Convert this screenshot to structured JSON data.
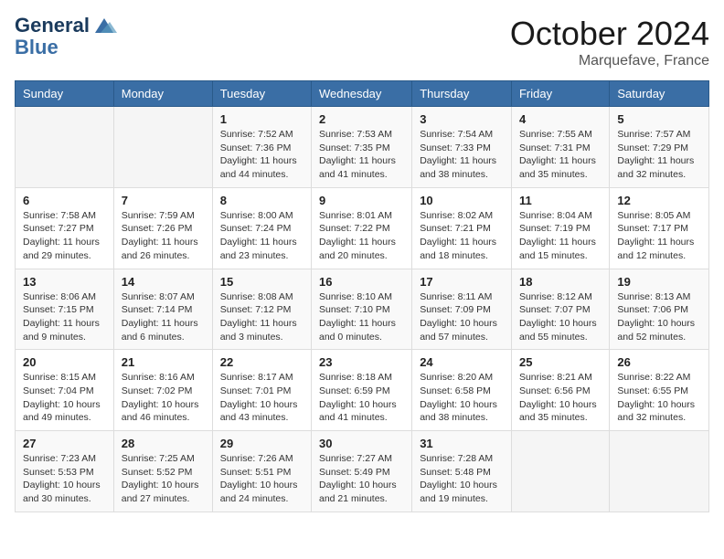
{
  "header": {
    "logo_line1": "General",
    "logo_line2": "Blue",
    "month": "October 2024",
    "location": "Marquefave, France"
  },
  "days_of_week": [
    "Sunday",
    "Monday",
    "Tuesday",
    "Wednesday",
    "Thursday",
    "Friday",
    "Saturday"
  ],
  "weeks": [
    [
      {
        "day": "",
        "content": ""
      },
      {
        "day": "",
        "content": ""
      },
      {
        "day": "1",
        "content": "Sunrise: 7:52 AM\nSunset: 7:36 PM\nDaylight: 11 hours and 44 minutes."
      },
      {
        "day": "2",
        "content": "Sunrise: 7:53 AM\nSunset: 7:35 PM\nDaylight: 11 hours and 41 minutes."
      },
      {
        "day": "3",
        "content": "Sunrise: 7:54 AM\nSunset: 7:33 PM\nDaylight: 11 hours and 38 minutes."
      },
      {
        "day": "4",
        "content": "Sunrise: 7:55 AM\nSunset: 7:31 PM\nDaylight: 11 hours and 35 minutes."
      },
      {
        "day": "5",
        "content": "Sunrise: 7:57 AM\nSunset: 7:29 PM\nDaylight: 11 hours and 32 minutes."
      }
    ],
    [
      {
        "day": "6",
        "content": "Sunrise: 7:58 AM\nSunset: 7:27 PM\nDaylight: 11 hours and 29 minutes."
      },
      {
        "day": "7",
        "content": "Sunrise: 7:59 AM\nSunset: 7:26 PM\nDaylight: 11 hours and 26 minutes."
      },
      {
        "day": "8",
        "content": "Sunrise: 8:00 AM\nSunset: 7:24 PM\nDaylight: 11 hours and 23 minutes."
      },
      {
        "day": "9",
        "content": "Sunrise: 8:01 AM\nSunset: 7:22 PM\nDaylight: 11 hours and 20 minutes."
      },
      {
        "day": "10",
        "content": "Sunrise: 8:02 AM\nSunset: 7:21 PM\nDaylight: 11 hours and 18 minutes."
      },
      {
        "day": "11",
        "content": "Sunrise: 8:04 AM\nSunset: 7:19 PM\nDaylight: 11 hours and 15 minutes."
      },
      {
        "day": "12",
        "content": "Sunrise: 8:05 AM\nSunset: 7:17 PM\nDaylight: 11 hours and 12 minutes."
      }
    ],
    [
      {
        "day": "13",
        "content": "Sunrise: 8:06 AM\nSunset: 7:15 PM\nDaylight: 11 hours and 9 minutes."
      },
      {
        "day": "14",
        "content": "Sunrise: 8:07 AM\nSunset: 7:14 PM\nDaylight: 11 hours and 6 minutes."
      },
      {
        "day": "15",
        "content": "Sunrise: 8:08 AM\nSunset: 7:12 PM\nDaylight: 11 hours and 3 minutes."
      },
      {
        "day": "16",
        "content": "Sunrise: 8:10 AM\nSunset: 7:10 PM\nDaylight: 11 hours and 0 minutes."
      },
      {
        "day": "17",
        "content": "Sunrise: 8:11 AM\nSunset: 7:09 PM\nDaylight: 10 hours and 57 minutes."
      },
      {
        "day": "18",
        "content": "Sunrise: 8:12 AM\nSunset: 7:07 PM\nDaylight: 10 hours and 55 minutes."
      },
      {
        "day": "19",
        "content": "Sunrise: 8:13 AM\nSunset: 7:06 PM\nDaylight: 10 hours and 52 minutes."
      }
    ],
    [
      {
        "day": "20",
        "content": "Sunrise: 8:15 AM\nSunset: 7:04 PM\nDaylight: 10 hours and 49 minutes."
      },
      {
        "day": "21",
        "content": "Sunrise: 8:16 AM\nSunset: 7:02 PM\nDaylight: 10 hours and 46 minutes."
      },
      {
        "day": "22",
        "content": "Sunrise: 8:17 AM\nSunset: 7:01 PM\nDaylight: 10 hours and 43 minutes."
      },
      {
        "day": "23",
        "content": "Sunrise: 8:18 AM\nSunset: 6:59 PM\nDaylight: 10 hours and 41 minutes."
      },
      {
        "day": "24",
        "content": "Sunrise: 8:20 AM\nSunset: 6:58 PM\nDaylight: 10 hours and 38 minutes."
      },
      {
        "day": "25",
        "content": "Sunrise: 8:21 AM\nSunset: 6:56 PM\nDaylight: 10 hours and 35 minutes."
      },
      {
        "day": "26",
        "content": "Sunrise: 8:22 AM\nSunset: 6:55 PM\nDaylight: 10 hours and 32 minutes."
      }
    ],
    [
      {
        "day": "27",
        "content": "Sunrise: 7:23 AM\nSunset: 5:53 PM\nDaylight: 10 hours and 30 minutes."
      },
      {
        "day": "28",
        "content": "Sunrise: 7:25 AM\nSunset: 5:52 PM\nDaylight: 10 hours and 27 minutes."
      },
      {
        "day": "29",
        "content": "Sunrise: 7:26 AM\nSunset: 5:51 PM\nDaylight: 10 hours and 24 minutes."
      },
      {
        "day": "30",
        "content": "Sunrise: 7:27 AM\nSunset: 5:49 PM\nDaylight: 10 hours and 21 minutes."
      },
      {
        "day": "31",
        "content": "Sunrise: 7:28 AM\nSunset: 5:48 PM\nDaylight: 10 hours and 19 minutes."
      },
      {
        "day": "",
        "content": ""
      },
      {
        "day": "",
        "content": ""
      }
    ]
  ]
}
